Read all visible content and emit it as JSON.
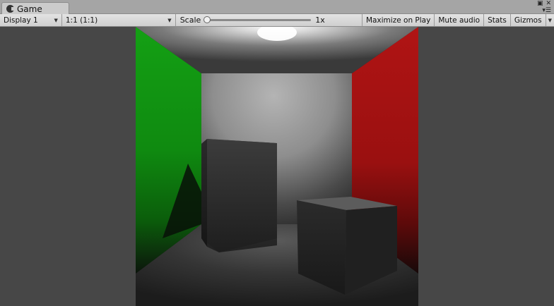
{
  "tab": {
    "title": "Game",
    "icon": "game-controller-icon"
  },
  "window_buttons": {
    "maximize_icon": "maximize-icon",
    "close_icon": "close-icon",
    "menu_icon": "tab-menu-icon"
  },
  "toolbar": {
    "display": "Display 1",
    "aspect": "1:1 (1:1)",
    "scale_label": "Scale",
    "scale_value": "1x",
    "scale_level": 0,
    "maximize_on_play": "Maximize on Play",
    "mute_audio": "Mute audio",
    "stats": "Stats",
    "gizmos": "Gizmos"
  },
  "scene_colors": {
    "left_wall": "#119a11",
    "right_wall": "#a51212",
    "back_wall": "#9b9b9b",
    "background": "#474747"
  }
}
